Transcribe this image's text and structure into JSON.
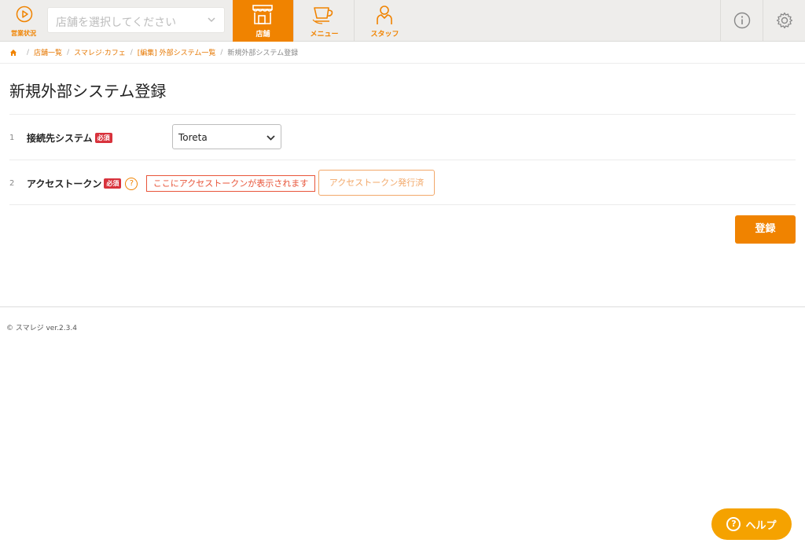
{
  "header": {
    "status_label": "営業状況",
    "store_select_placeholder": "店舗を選択してください",
    "nav": [
      {
        "label": "店舗",
        "active": true
      },
      {
        "label": "メニュー",
        "active": false
      },
      {
        "label": "スタッフ",
        "active": false
      }
    ],
    "accent_color": "#f08300"
  },
  "breadcrumb": {
    "items": [
      "店舗一覧",
      "スマレジ·カフェ",
      "[編集] 外部システム一覧"
    ],
    "current": "新規外部システム登録"
  },
  "page": {
    "title": "新規外部システム登録"
  },
  "form": {
    "rows": [
      {
        "num": "1",
        "label": "接続先システム",
        "badge": "必須",
        "value": "Toreta"
      },
      {
        "num": "2",
        "label": "アクセストークン",
        "badge": "必須",
        "help": "?",
        "token_text": "ここにアクセストークンが表示されます",
        "token_button": "アクセストークン発行済"
      }
    ],
    "submit_label": "登録"
  },
  "footer": {
    "copyright": "© スマレジ ver.2.3.4"
  },
  "help_fab": {
    "label": "ヘルプ",
    "icon_text": "?"
  }
}
